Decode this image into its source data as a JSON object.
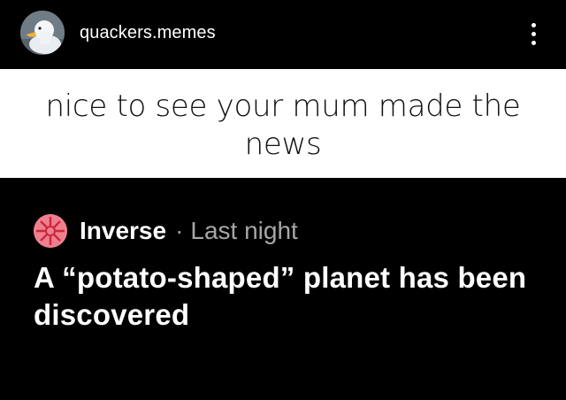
{
  "header": {
    "avatar_icon": "duck-avatar-icon",
    "username": "quackers.memes",
    "more_icon": "more-vertical-icon"
  },
  "caption": {
    "text": "nice to see your mum made the news"
  },
  "post": {
    "source_icon": "inverse-logo-icon",
    "source_name": "Inverse",
    "separator": "·",
    "timestamp": "Last night",
    "headline": "A “potato-shaped” planet has been discovered"
  },
  "colors": {
    "background": "#000000",
    "caption_background": "#ffffff",
    "caption_text": "#111111",
    "muted_text": "#a6a6a6",
    "source_icon_bg": "#f07f8e"
  }
}
